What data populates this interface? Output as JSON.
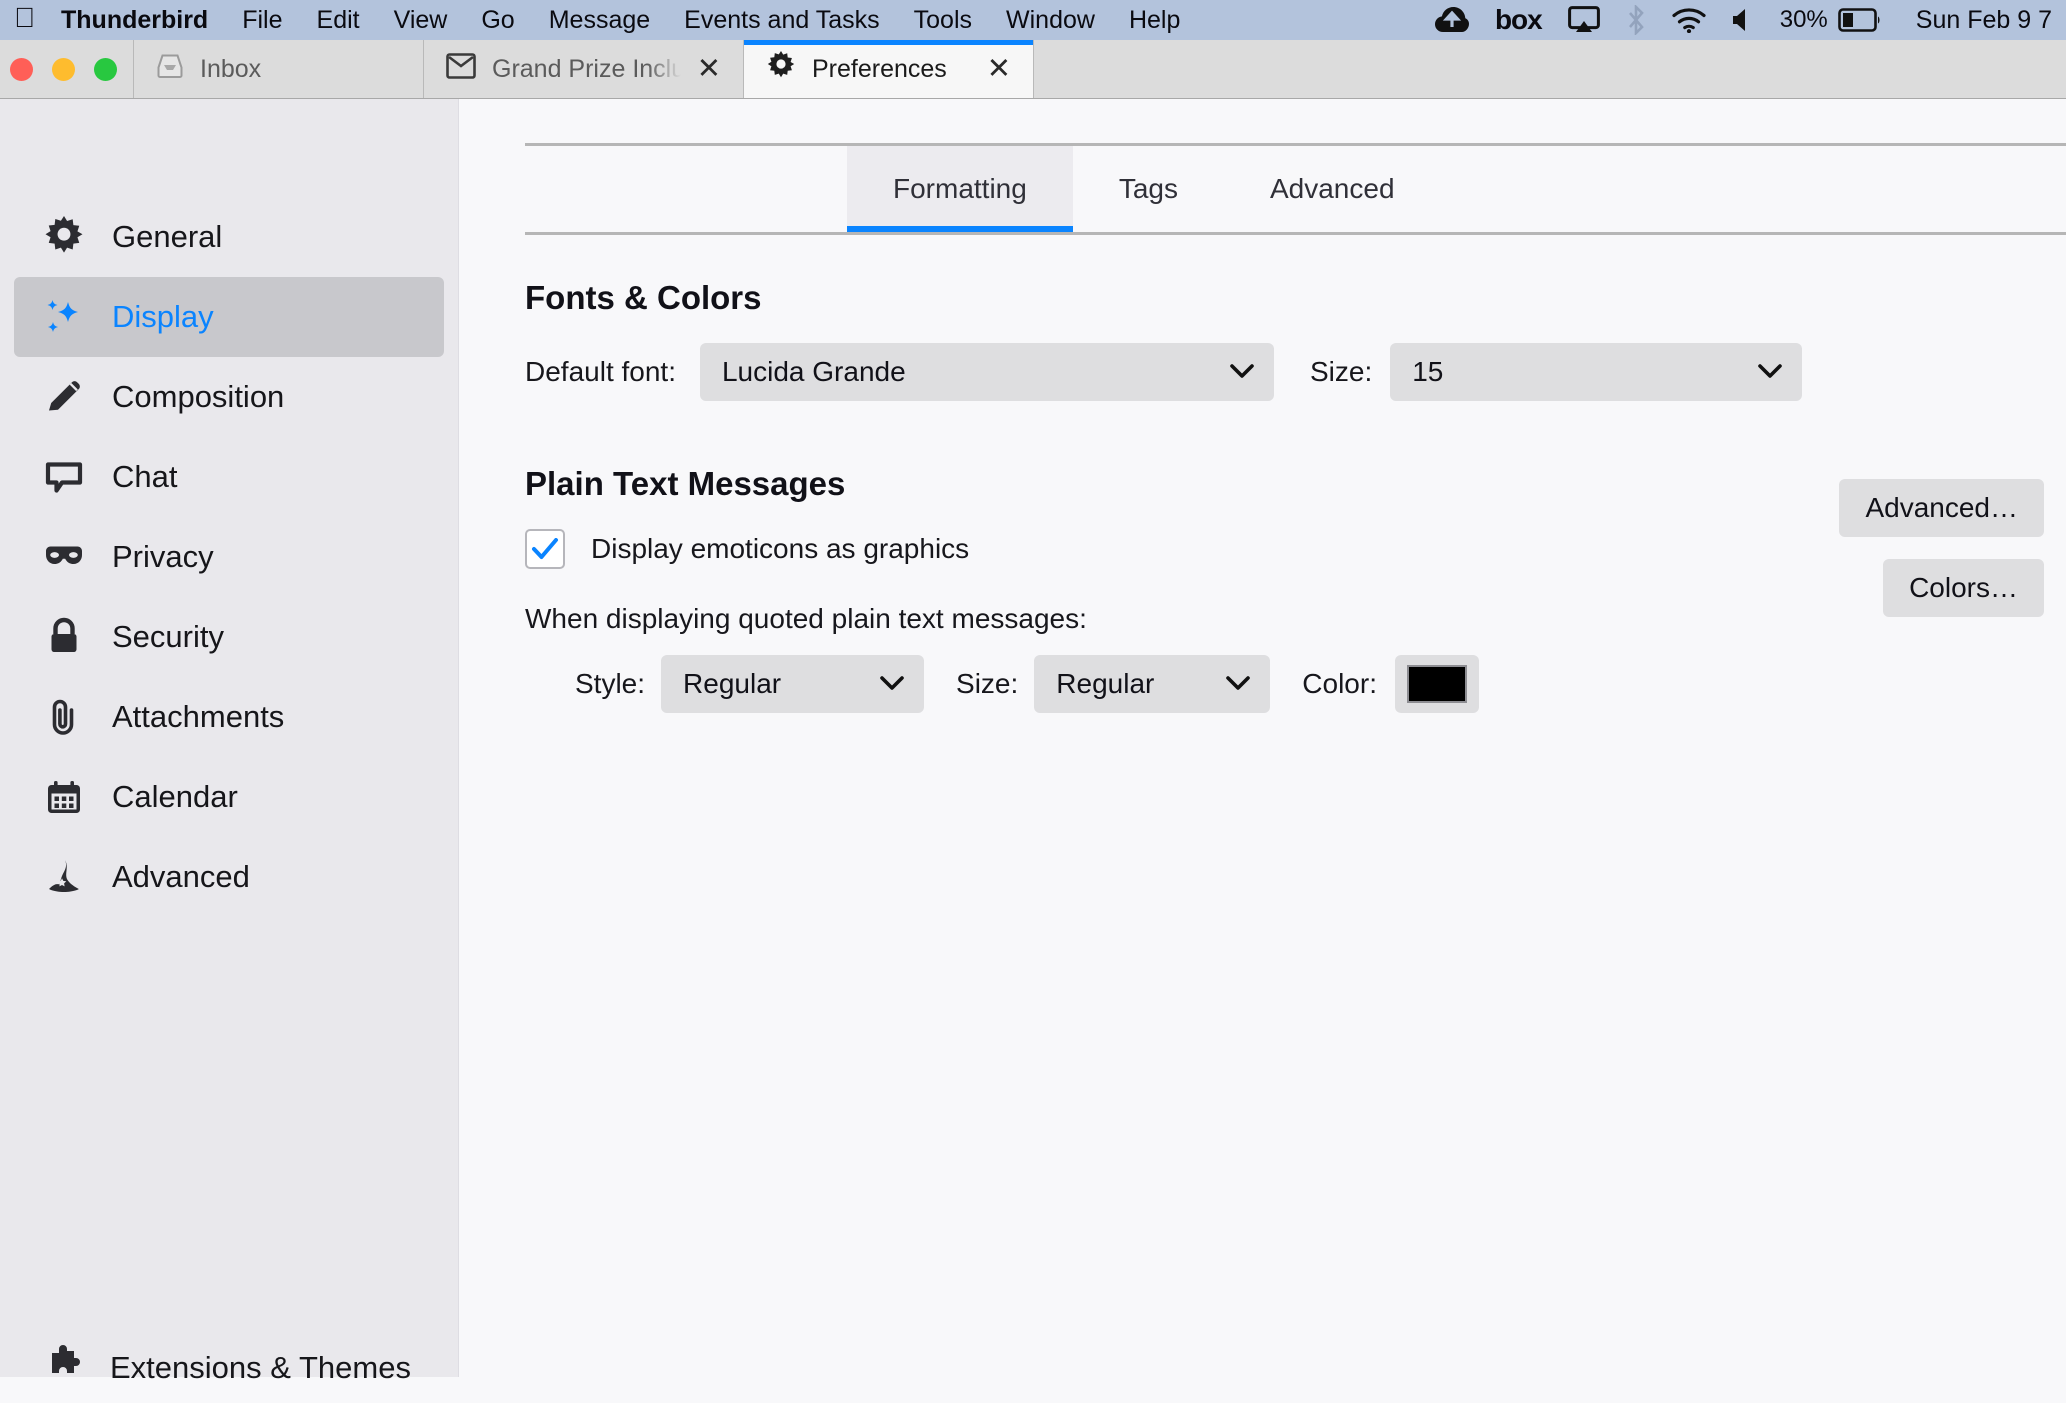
{
  "menubar": {
    "apple_icon": "apple-logo",
    "items": [
      "Thunderbird",
      "File",
      "Edit",
      "View",
      "Go",
      "Message",
      "Events and Tasks",
      "Tools",
      "Window",
      "Help"
    ],
    "status_icons": [
      "cloud-upload-icon",
      "box-icon",
      "airplay-icon",
      "bluetooth-icon",
      "wifi-icon",
      "volume-icon"
    ],
    "battery_percent": "30%",
    "clock": "Sun Feb 9  7",
    "background_color": "#B3C3DC"
  },
  "tabstrip": {
    "tabs": [
      {
        "label": "Inbox",
        "icon": "inbox-tray-icon",
        "active": false,
        "closable": false
      },
      {
        "label": "Grand Prize Includes a Coast",
        "icon": "envelope-icon",
        "active": false,
        "closable": true
      },
      {
        "label": "Preferences",
        "icon": "gear-icon",
        "active": true,
        "closable": true
      }
    ],
    "close_glyph": "✕",
    "active_accent": "#0A84FF"
  },
  "sidebar": {
    "items": [
      {
        "label": "General",
        "icon": "gear-icon",
        "selected": false
      },
      {
        "label": "Display",
        "icon": "sparkles-icon",
        "selected": true
      },
      {
        "label": "Composition",
        "icon": "pencil-icon",
        "selected": false
      },
      {
        "label": "Chat",
        "icon": "speech-bubble-icon",
        "selected": false
      },
      {
        "label": "Privacy",
        "icon": "mask-icon",
        "selected": false
      },
      {
        "label": "Security",
        "icon": "lock-icon",
        "selected": false
      },
      {
        "label": "Attachments",
        "icon": "paperclip-icon",
        "selected": false
      },
      {
        "label": "Calendar",
        "icon": "calendar-icon",
        "selected": false
      },
      {
        "label": "Advanced",
        "icon": "wizard-hat-icon",
        "selected": false
      }
    ],
    "partial_item": {
      "label": "Extensions & Themes",
      "icon": "puzzle-icon"
    },
    "selected_text_color": "#0A84FF",
    "selected_bg_color": "#C8C8CC"
  },
  "prefs_tabs": {
    "items": [
      {
        "label": "Formatting",
        "active": true
      },
      {
        "label": "Tags",
        "active": false
      },
      {
        "label": "Advanced",
        "active": false
      }
    ]
  },
  "fonts_colors": {
    "title": "Fonts & Colors",
    "default_font_label": "Default font:",
    "default_font_value": "Lucida Grande",
    "size_label": "Size:",
    "size_value": "15",
    "advanced_button": "Advanced…",
    "colors_button": "Colors…",
    "chevron": "⌄"
  },
  "plain_text": {
    "title": "Plain Text Messages",
    "emoticons_label": "Display emoticons as graphics",
    "emoticons_checked": true,
    "quoted_label": "When displaying quoted plain text messages:",
    "style_label": "Style:",
    "style_value": "Regular",
    "size_label": "Size:",
    "size_value": "Regular",
    "color_label": "Color:",
    "color_value": "#000000"
  }
}
